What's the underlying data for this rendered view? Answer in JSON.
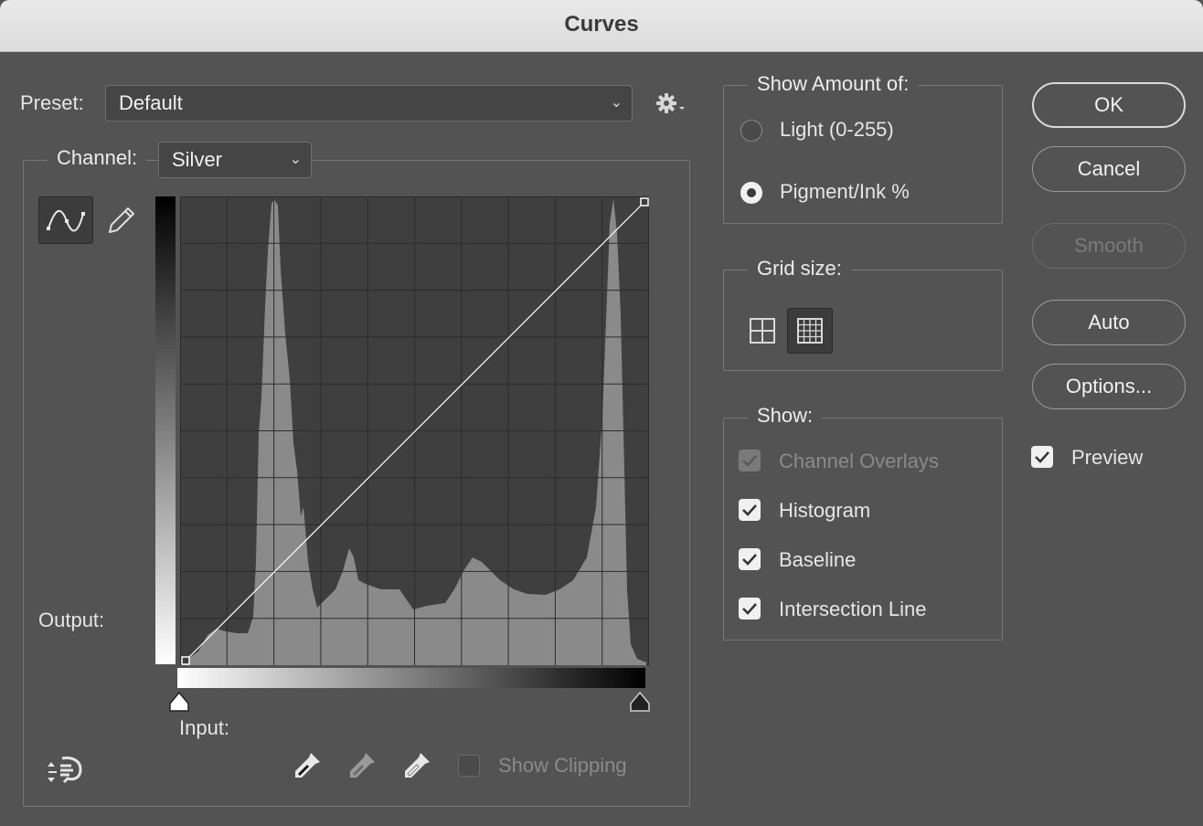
{
  "window": {
    "title": "Curves"
  },
  "preset": {
    "label": "Preset:",
    "value": "Default"
  },
  "channel": {
    "label": "Channel:",
    "value": "Silver"
  },
  "graph": {
    "output_label": "Output:",
    "input_label": "Input:",
    "show_clipping_label": "Show Clipping"
  },
  "show_amount": {
    "title": "Show Amount of:",
    "options": [
      {
        "label": "Light  (0-255)",
        "selected": false
      },
      {
        "label": "Pigment/Ink %",
        "selected": true
      }
    ]
  },
  "grid_size": {
    "title": "Grid size:",
    "selected": "fine"
  },
  "show": {
    "title": "Show:",
    "items": [
      {
        "label": "Channel Overlays",
        "checked": true,
        "disabled": true
      },
      {
        "label": "Histogram",
        "checked": true,
        "disabled": false
      },
      {
        "label": "Baseline",
        "checked": true,
        "disabled": false
      },
      {
        "label": "Intersection Line",
        "checked": true,
        "disabled": false
      }
    ]
  },
  "buttons": {
    "ok": "OK",
    "cancel": "Cancel",
    "smooth": "Smooth",
    "auto": "Auto",
    "options": "Options..."
  },
  "preview": {
    "label": "Preview",
    "checked": true
  },
  "icons": {
    "gear": "gear-icon",
    "curve_tool": "curve-tool-icon",
    "pencil": "pencil-icon",
    "hand": "on-image-adjustment-icon",
    "eyedropper_black": "black-eyedropper-icon",
    "eyedropper_gray": "gray-eyedropper-icon",
    "eyedropper_white": "white-eyedropper-icon"
  },
  "colors": {
    "background": "#535353",
    "histogram": "#8a8a8a",
    "graph_bg": "#3f3f3f",
    "curve": "#ffffff"
  }
}
